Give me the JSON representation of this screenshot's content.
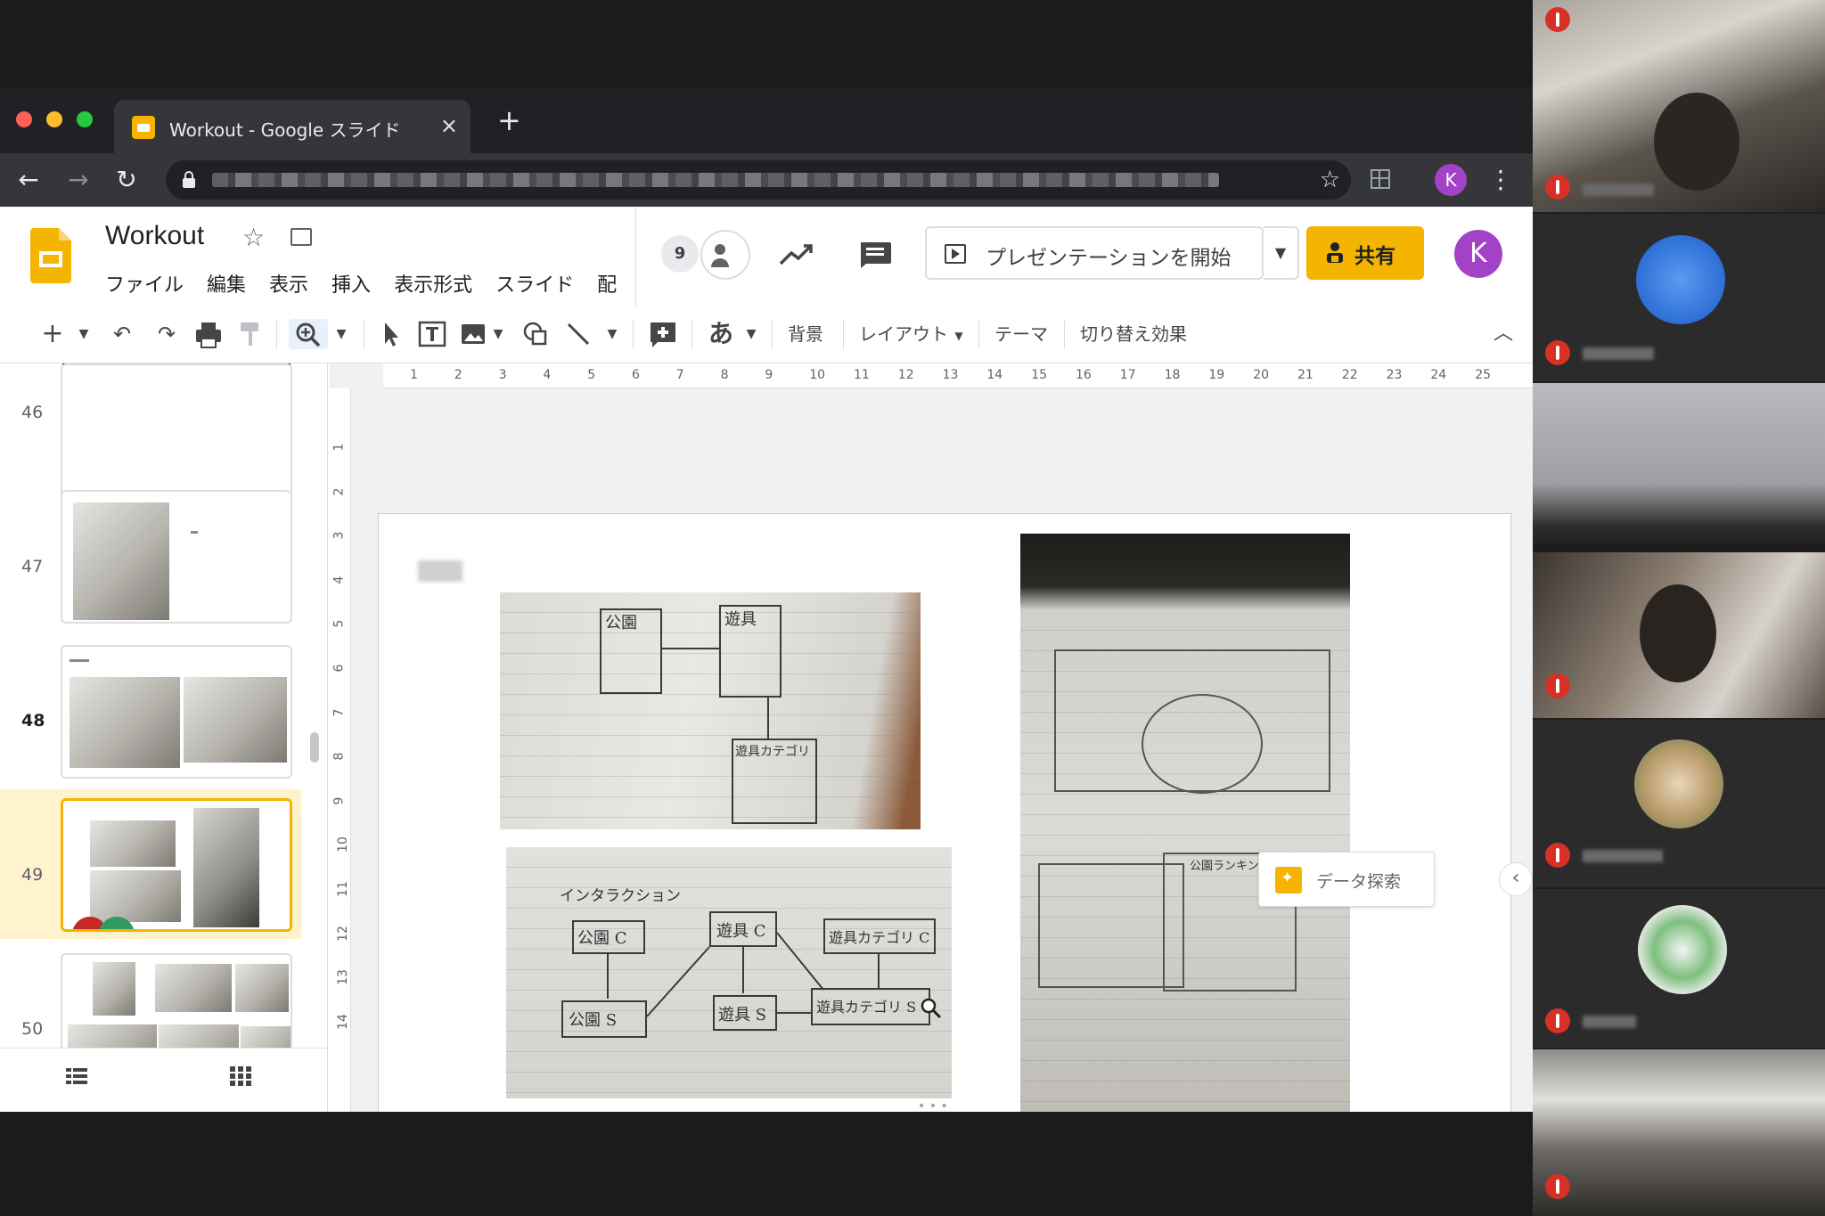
{
  "browser": {
    "tab_title": "Workout - Google スライド",
    "tab_close": "×",
    "new_tab": "+",
    "profile_initial": "K"
  },
  "slides": {
    "doc_title": "Workout",
    "menu": [
      "ファイル",
      "編集",
      "表示",
      "挿入",
      "表示形式",
      "スライド",
      "配"
    ],
    "viewer_count": "9",
    "present_label": "プレゼンテーションを開始",
    "share_label": "共有",
    "account_initial": "K"
  },
  "toolbar": {
    "ime_char": "あ",
    "background": "背景",
    "layout": "レイアウト",
    "theme": "テーマ",
    "transition": "切り替え効果"
  },
  "filmstrip": {
    "slide_numbers": [
      "46",
      "47",
      "48",
      "49",
      "50"
    ],
    "selected": "48"
  },
  "ruler": {
    "horizontal": [
      "1",
      "2",
      "3",
      "4",
      "5",
      "6",
      "7",
      "8",
      "9",
      "10",
      "11",
      "12",
      "13",
      "14",
      "15",
      "16",
      "17",
      "18",
      "19",
      "20",
      "21",
      "22",
      "23",
      "24",
      "25"
    ],
    "vertical": [
      "1",
      "2",
      "3",
      "4",
      "5",
      "6",
      "7",
      "8",
      "9",
      "10",
      "11",
      "12",
      "13",
      "14"
    ]
  },
  "slide": {
    "sketch_1_labels": [
      "公園",
      "遊具",
      "遊具カテゴリ"
    ],
    "sketch_2_heading": "インタラクション",
    "sketch_2_boxes": [
      "公園 C",
      "遊具 C",
      "遊具カテゴリ C",
      "公園 S",
      "遊具 S",
      "遊具カテゴリ S"
    ],
    "sketch_3_label": "公園ランキング"
  },
  "explore_label": "データ探索",
  "colors": {
    "slides_yellow": "#f4b400",
    "avatar_purple": "#a142c7",
    "mic_off_red": "#d93025"
  }
}
